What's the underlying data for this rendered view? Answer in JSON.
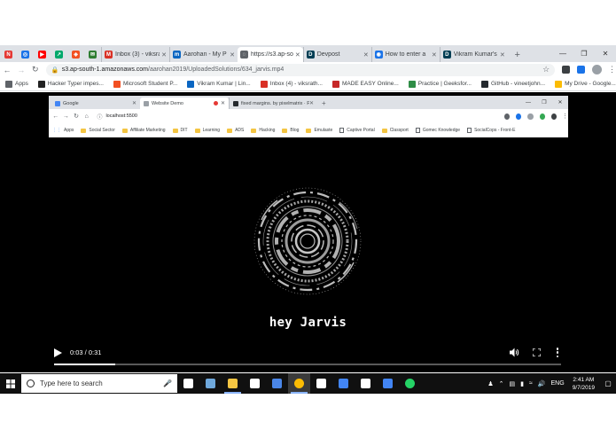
{
  "outer_browser": {
    "tabs": [
      {
        "title": "",
        "favicon": "N",
        "color": "#e53935",
        "kind": "pinned"
      },
      {
        "title": "",
        "favicon": "◎",
        "color": "#1a73e8",
        "kind": "pinned"
      },
      {
        "title": "",
        "favicon": "▶",
        "color": "#ff0000",
        "kind": "pinned"
      },
      {
        "title": "",
        "favicon": "↗",
        "color": "#00a86b",
        "kind": "pinned"
      },
      {
        "title": "",
        "favicon": "◈",
        "color": "#f25022",
        "kind": "pinned"
      },
      {
        "title": "",
        "favicon": "✉",
        "color": "#2e7d32",
        "kind": "pinned"
      },
      {
        "title": "Inbox (3) - viksra",
        "favicon": "M",
        "color": "#d93025",
        "kind": "normal"
      },
      {
        "title": "Aarohan - My P",
        "favicon": "m",
        "color": "#0a66c2",
        "kind": "normal"
      },
      {
        "title": "https://s3.ap-so",
        "favicon": "◌",
        "color": "#5f6368",
        "kind": "active"
      },
      {
        "title": "Devpost",
        "favicon": "D",
        "color": "#003e54",
        "kind": "normal"
      },
      {
        "title": "How to enter a",
        "favicon": "◉",
        "color": "#1a73e8",
        "kind": "normal"
      },
      {
        "title": "Vikram Kumar's",
        "favicon": "D",
        "color": "#003e54",
        "kind": "normal"
      }
    ],
    "new_tab": "+",
    "window_controls": [
      "—",
      "❐",
      "✕"
    ],
    "url_host": "s3.ap-south-1.amazonaws.com",
    "url_path": "/aarohan2019/UploadedSolutions/634_jarvis.mp4",
    "bookmarks": [
      {
        "label": "Apps",
        "icon": "grid-icon",
        "color": "#5f6368"
      },
      {
        "label": "Hacker Typer impes...",
        "icon": "hacker-typer-icon",
        "color": "#222222"
      },
      {
        "label": "Microsoft Student P...",
        "icon": "microsoft-icon",
        "color": "#f25022"
      },
      {
        "label": "Vikram Kumar | Lin...",
        "icon": "linkedin-icon",
        "color": "#0a66c2"
      },
      {
        "label": "Inbox (4) - viksrath...",
        "icon": "gmail-icon",
        "color": "#d93025"
      },
      {
        "label": "MADE EASY Online...",
        "icon": "madeeasy-icon",
        "color": "#c62828"
      },
      {
        "label": "Practice | Geeksfor...",
        "icon": "gfg-icon",
        "color": "#2f8d46"
      },
      {
        "label": "GitHub - vineetjohn...",
        "icon": "github-icon",
        "color": "#24292e"
      },
      {
        "label": "My Drive - Google...",
        "icon": "drive-icon",
        "color": "#fbbc04"
      }
    ]
  },
  "inner_browser": {
    "tabs": [
      {
        "title": "Google",
        "color": "#4285f4"
      },
      {
        "title": "Website Demo",
        "color": "#9aa0a6",
        "recording": true
      },
      {
        "title": "fixed margins. by pixelmatrix · P",
        "color": "#24292e"
      }
    ],
    "new_tab": "+",
    "window_controls": [
      "—",
      "❐",
      "✕"
    ],
    "url": "localhost:5500",
    "bookmarks": [
      {
        "label": "Apps",
        "kind": "apps"
      },
      {
        "label": "Social Sector",
        "kind": "folder"
      },
      {
        "label": "Affiliate Marketing",
        "kind": "folder"
      },
      {
        "label": "DIT",
        "kind": "folder"
      },
      {
        "label": "Learning",
        "kind": "folder"
      },
      {
        "label": "ADS",
        "kind": "folder"
      },
      {
        "label": "Hacking",
        "kind": "folder"
      },
      {
        "label": "Blog",
        "kind": "folder"
      },
      {
        "label": "Emulaste",
        "kind": "folder"
      },
      {
        "label": "Captive Portal",
        "kind": "page"
      },
      {
        "label": "Classport",
        "kind": "folder"
      },
      {
        "label": "Gomec Knowledge",
        "kind": "page"
      },
      {
        "label": "SocialCops - Front-E",
        "kind": "page"
      }
    ]
  },
  "video": {
    "caption": "hey Jarvis",
    "time": "0:03 / 0:31",
    "progress": 0.12
  },
  "taskbar": {
    "search_placeholder": "Type here to search",
    "apps": [
      {
        "name": "task-view",
        "color": "#ffffff",
        "running": false
      },
      {
        "name": "paint-app",
        "color": "#6fa8dc",
        "running": false
      },
      {
        "name": "file-explorer",
        "color": "#f4c542",
        "running": true
      },
      {
        "name": "store",
        "color": "#ffffff",
        "running": false
      },
      {
        "name": "office-app",
        "color": "#4a86e8",
        "running": false
      },
      {
        "name": "chrome",
        "color": "#fbbc04",
        "running": true,
        "active": true
      },
      {
        "name": "notepad-app",
        "color": "#ffffff",
        "running": false
      },
      {
        "name": "snip-tool",
        "color": "#4285f4",
        "running": false
      },
      {
        "name": "vscode-app",
        "color": "#ffffff",
        "running": false
      },
      {
        "name": "word-app",
        "color": "#4285f4",
        "running": false
      },
      {
        "name": "whatsapp",
        "color": "#25d366",
        "running": false
      }
    ],
    "language": "ENG",
    "time": "2:41 AM",
    "date": "9/7/2019"
  }
}
